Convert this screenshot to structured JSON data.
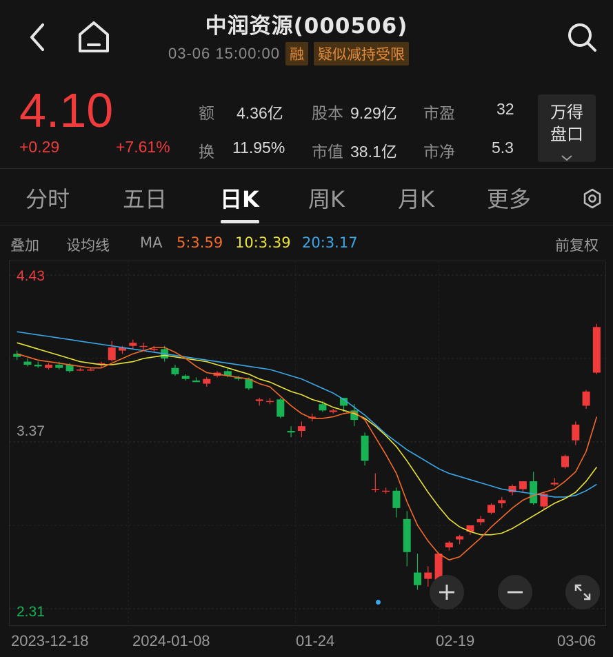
{
  "header": {
    "title": "中润资源(000506)",
    "datetime": "03-06 15:00:00",
    "tag_margin": "融",
    "tag_warning": "疑似减持受限"
  },
  "quote": {
    "price": "4.10",
    "change": "+0.29",
    "change_pct": "+7.61%",
    "amount_label": "额",
    "amount_value": "4.36亿",
    "equity_label": "股本",
    "equity_value": "9.29亿",
    "pe_label": "市盈",
    "pe_value": "32",
    "turnover_label": "换",
    "turnover_value": "11.95%",
    "mktcap_label": "市值",
    "mktcap_value": "38.1亿",
    "pb_label": "市净",
    "pb_value": "5.3",
    "wind_button_line1": "万得",
    "wind_button_line2": "盘口"
  },
  "tabs": [
    {
      "label": "分时"
    },
    {
      "label": "五日"
    },
    {
      "label": "日K"
    },
    {
      "label": "周K"
    },
    {
      "label": "月K"
    },
    {
      "label": "更多"
    }
  ],
  "active_tab": "日K",
  "ma_bar": {
    "overlay": "叠加",
    "set_ma": "设均线",
    "ma_label": "MA",
    "ma5": "5:3.59",
    "ma10": "10:3.39",
    "ma20": "20:3.17",
    "adjust": "前复权",
    "colors": {
      "ma5": "#f26a2a",
      "ma10": "#e8e23a",
      "ma20": "#3aa7e8",
      "up": "#ef3b3b",
      "down": "#19b355"
    }
  },
  "chart_data": {
    "type": "candlestick",
    "y_high_label": "4.43",
    "y_mid_label": "3.37",
    "y_low_label": "2.31",
    "ylim": [
      2.31,
      4.43
    ],
    "x_labels": [
      "2023-12-18",
      "2024-01-08",
      "01-24",
      "02-19",
      "03-06"
    ],
    "ohlc": [
      [
        3.93,
        3.95,
        3.89,
        3.91
      ],
      [
        3.88,
        3.9,
        3.85,
        3.86
      ],
      [
        3.86,
        3.88,
        3.84,
        3.85
      ],
      [
        3.84,
        3.87,
        3.83,
        3.86
      ],
      [
        3.86,
        3.88,
        3.83,
        3.84
      ],
      [
        3.86,
        3.87,
        3.81,
        3.82
      ],
      [
        3.83,
        3.84,
        3.82,
        3.83
      ],
      [
        3.83,
        3.84,
        3.82,
        3.83
      ],
      [
        3.86,
        3.88,
        3.84,
        3.87
      ],
      [
        3.89,
        4.01,
        3.88,
        3.97
      ],
      [
        3.95,
        3.98,
        3.93,
        3.97
      ],
      [
        3.98,
        4.02,
        3.96,
        4.0
      ],
      [
        3.98,
        4.0,
        3.95,
        3.98
      ],
      [
        3.96,
        3.98,
        3.94,
        3.96
      ],
      [
        3.96,
        3.98,
        3.88,
        3.9
      ],
      [
        3.84,
        3.86,
        3.79,
        3.8
      ],
      [
        3.79,
        3.8,
        3.76,
        3.77
      ],
      [
        3.76,
        3.78,
        3.75,
        3.75
      ],
      [
        3.74,
        3.78,
        3.72,
        3.77
      ],
      [
        3.79,
        3.82,
        3.78,
        3.81
      ],
      [
        3.82,
        3.84,
        3.78,
        3.79
      ],
      [
        3.78,
        3.79,
        3.76,
        3.77
      ],
      [
        3.77,
        3.78,
        3.7,
        3.71
      ],
      [
        3.63,
        3.65,
        3.6,
        3.64
      ],
      [
        3.63,
        3.65,
        3.61,
        3.63
      ],
      [
        3.64,
        3.65,
        3.52,
        3.53
      ],
      [
        3.44,
        3.47,
        3.4,
        3.43
      ],
      [
        3.44,
        3.5,
        3.4,
        3.47
      ],
      [
        3.52,
        3.55,
        3.5,
        3.53
      ],
      [
        3.61,
        3.63,
        3.56,
        3.57
      ],
      [
        3.56,
        3.58,
        3.55,
        3.57
      ],
      [
        3.65,
        3.65,
        3.56,
        3.6
      ],
      [
        3.57,
        3.61,
        3.47,
        3.51
      ],
      [
        3.41,
        3.43,
        3.22,
        3.25
      ],
      [
        3.07,
        3.17,
        3.05,
        3.07
      ],
      [
        3.06,
        3.08,
        3.04,
        3.06
      ],
      [
        3.06,
        3.08,
        2.89,
        2.95
      ],
      [
        2.88,
        2.93,
        2.58,
        2.67
      ],
      [
        2.54,
        2.66,
        2.43,
        2.46
      ],
      [
        2.5,
        2.58,
        2.45,
        2.54
      ],
      [
        2.48,
        2.66,
        2.47,
        2.66
      ],
      [
        2.7,
        2.74,
        2.68,
        2.73
      ],
      [
        2.75,
        2.78,
        2.72,
        2.77
      ],
      [
        2.8,
        2.84,
        2.78,
        2.84
      ],
      [
        2.86,
        2.9,
        2.84,
        2.88
      ],
      [
        2.92,
        2.98,
        2.91,
        2.97
      ],
      [
        2.98,
        3.02,
        2.95,
        3.0
      ],
      [
        3.05,
        3.1,
        3.03,
        3.09
      ],
      [
        3.07,
        3.12,
        3.05,
        3.12
      ],
      [
        3.12,
        3.18,
        2.97,
        2.98
      ],
      [
        2.96,
        3.05,
        2.94,
        3.04
      ],
      [
        3.1,
        3.14,
        3.09,
        3.11
      ],
      [
        3.21,
        3.29,
        3.2,
        3.28
      ],
      [
        3.38,
        3.5,
        3.35,
        3.48
      ],
      [
        3.6,
        3.7,
        3.58,
        3.69
      ],
      [
        3.81,
        4.12,
        3.8,
        4.1
      ]
    ],
    "ma5": [
      3.93,
      3.91,
      3.89,
      3.88,
      3.87,
      3.86,
      3.85,
      3.84,
      3.84,
      3.87,
      3.9,
      3.93,
      3.95,
      3.97,
      3.97,
      3.94,
      3.9,
      3.85,
      3.81,
      3.8,
      3.79,
      3.78,
      3.77,
      3.74,
      3.72,
      3.66,
      3.6,
      3.55,
      3.52,
      3.52,
      3.53,
      3.55,
      3.56,
      3.51,
      3.4,
      3.29,
      3.17,
      2.99,
      2.84,
      2.74,
      2.66,
      2.62,
      2.64,
      2.7,
      2.76,
      2.83,
      2.89,
      2.95,
      3.0,
      3.03,
      3.05,
      3.07,
      3.12,
      3.18,
      3.31,
      3.53
    ],
    "ma10": [
      4.0,
      3.98,
      3.96,
      3.94,
      3.92,
      3.9,
      3.88,
      3.87,
      3.86,
      3.86,
      3.87,
      3.88,
      3.9,
      3.91,
      3.92,
      3.91,
      3.9,
      3.89,
      3.88,
      3.86,
      3.84,
      3.82,
      3.8,
      3.77,
      3.75,
      3.72,
      3.69,
      3.67,
      3.64,
      3.62,
      3.59,
      3.57,
      3.55,
      3.52,
      3.47,
      3.41,
      3.34,
      3.25,
      3.15,
      3.05,
      2.96,
      2.88,
      2.83,
      2.8,
      2.78,
      2.78,
      2.79,
      2.82,
      2.86,
      2.9,
      2.94,
      2.98,
      3.01,
      3.05,
      3.12,
      3.21
    ],
    "ma20": [
      4.07,
      4.06,
      4.05,
      4.04,
      4.03,
      4.02,
      4.01,
      4.0,
      3.99,
      3.98,
      3.97,
      3.96,
      3.95,
      3.94,
      3.93,
      3.92,
      3.91,
      3.9,
      3.89,
      3.88,
      3.87,
      3.86,
      3.85,
      3.84,
      3.83,
      3.81,
      3.79,
      3.77,
      3.74,
      3.71,
      3.68,
      3.64,
      3.59,
      3.54,
      3.48,
      3.42,
      3.37,
      3.32,
      3.28,
      3.24,
      3.2,
      3.17,
      3.15,
      3.13,
      3.11,
      3.09,
      3.07,
      3.06,
      3.05,
      3.04,
      3.03,
      3.02,
      3.02,
      3.03,
      3.06,
      3.1
    ]
  }
}
